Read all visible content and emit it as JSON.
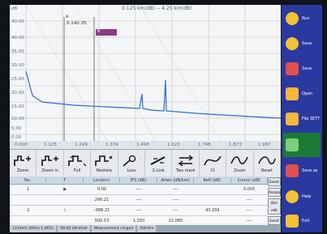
{
  "trace": {
    "top_info": "0.125 km(dB) -- 4.25 km(dB)",
    "marker_a_label": "A",
    "marker_a_value": "0.140.35",
    "marker_b_label": "B",
    "y_ticks": [
      "dB",
      "40.00",
      "40.00",
      "35.00",
      "30.00",
      "25.00",
      "20.00",
      "15.00",
      "10.00",
      "5.00",
      "0.00"
    ],
    "x_ticks": [
      "0.000",
      "1.125",
      "1.249",
      "1.374",
      "1.498",
      "1.623",
      "1.748",
      "1.873",
      "1.997"
    ],
    "colors": {
      "trace": "#2f6bd6",
      "grid": "#b9c3cf",
      "marker": "#555",
      "label_bg": "#8a3a8a"
    }
  },
  "toolbar": [
    {
      "icon": "zoom-in-icon",
      "label": "Zoom"
    },
    {
      "icon": "zoom-in-2-icon",
      "label": "Zoom in"
    },
    {
      "icon": "fit-icon",
      "label": "Full"
    },
    {
      "icon": "restore-icon",
      "label": "Restore"
    },
    {
      "icon": "loss-icon",
      "label": "Loss"
    },
    {
      "icon": "link-icon",
      "label": "2-Link"
    },
    {
      "icon": "two-mark-icon",
      "label": "Two mark"
    },
    {
      "icon": "curve-icon",
      "label": "Ct"
    },
    {
      "icon": "zoom-wave-icon",
      "label": "Zoom"
    },
    {
      "icon": "reset-icon",
      "label": "Reset"
    }
  ],
  "table": {
    "headers": [
      "No.",
      "T",
      "Loc(km)",
      "IFS (dB)",
      "Atten (dB/km)",
      "Refl (dB)",
      "Cumul (dB)"
    ],
    "rows": [
      [
        "1",
        "▶",
        "0.00",
        "----",
        "----",
        "",
        "0.000"
      ],
      [
        "",
        "",
        "266.21",
        "----",
        "----",
        "",
        "----"
      ],
      [
        "2",
        "⌇",
        "-998.21",
        "----",
        "----",
        "43.204",
        "----"
      ],
      [
        "",
        "",
        "500.53",
        "1.250",
        "21.085",
        "",
        "----"
      ]
    ],
    "side_buttons": [
      "Event",
      "Analyze",
      "Dist edit",
      "Event"
    ]
  },
  "status": [
    "1310nm  200ns  1.4655",
    "00:40  Ultrafast",
    "Measurement  ranged",
    "400 Km"
  ],
  "right_panel": [
    {
      "label": "Run",
      "icon": "gear-icon",
      "color": "#f1c232"
    },
    {
      "label": "Save",
      "icon": "disc-icon",
      "color": "#f1c232"
    },
    {
      "label": "Save",
      "icon": "save-icon",
      "color": "#e05050"
    },
    {
      "label": "Open",
      "icon": "folder-icon",
      "color": "#f6b73c"
    },
    {
      "label": "File SETT",
      "icon": "file-icon",
      "color": "#f6b73c"
    },
    {
      "label": "",
      "icon": "list-icon",
      "color": "#7ccf7c"
    },
    {
      "label": "Save as",
      "icon": "save-as-icon",
      "color": "#e05050"
    },
    {
      "label": "Help",
      "icon": "help-icon",
      "color": "#f1c232"
    },
    {
      "label": "Exit",
      "icon": "home-icon",
      "color": "#f1c232"
    }
  ]
}
